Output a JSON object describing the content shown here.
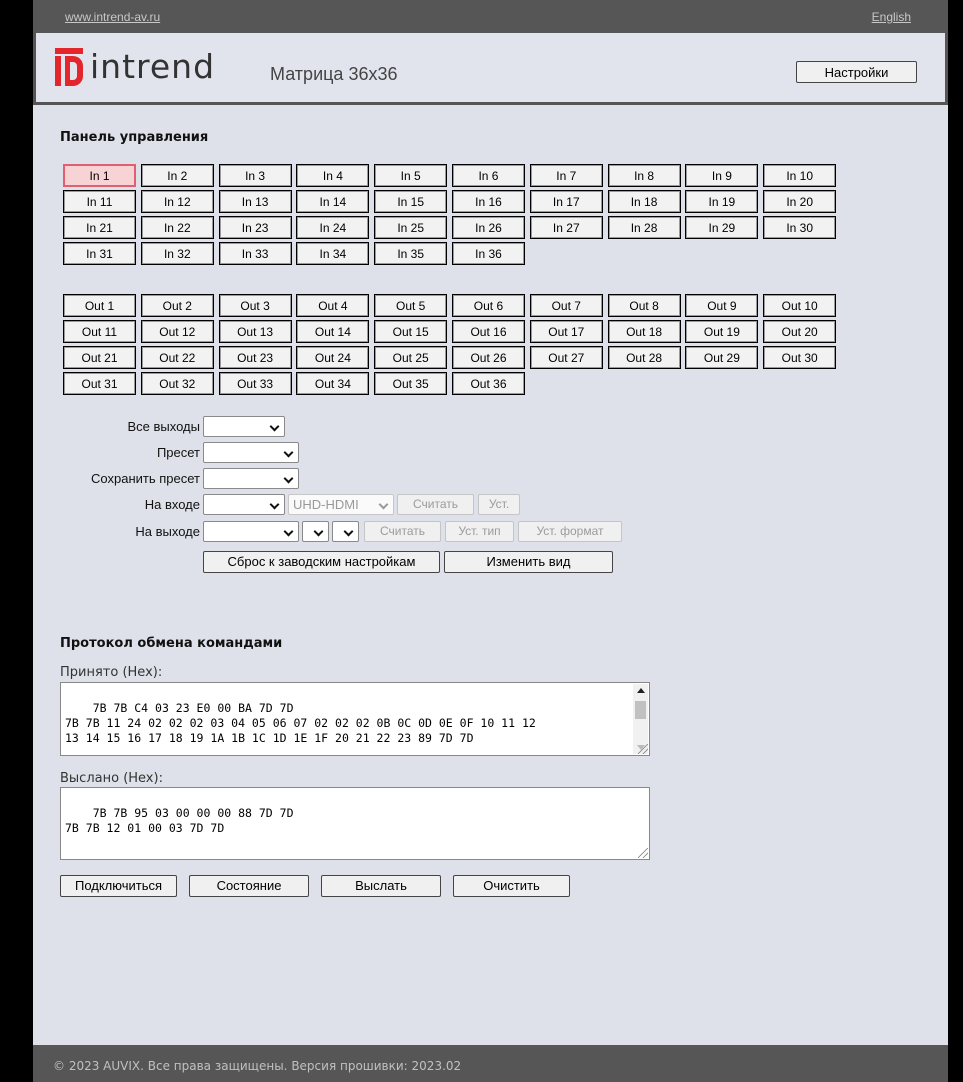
{
  "topbar": {
    "site": "www.intrend-av.ru",
    "lang": "English"
  },
  "header": {
    "brand": "intrend",
    "product": "Матрица 36x36",
    "settings_label": "Настройки",
    "accent_color": "#e4262c"
  },
  "panel": {
    "title": "Панель управления",
    "inputs": [
      "In 1",
      "In 2",
      "In 3",
      "In 4",
      "In 5",
      "In 6",
      "In 7",
      "In 8",
      "In 9",
      "In 10",
      "In 11",
      "In 12",
      "In 13",
      "In 14",
      "In 15",
      "In 16",
      "In 17",
      "In 18",
      "In 19",
      "In 20",
      "In 21",
      "In 22",
      "In 23",
      "In 24",
      "In 25",
      "In 26",
      "In 27",
      "In 28",
      "In 29",
      "In 30",
      "In 31",
      "In 32",
      "In 33",
      "In 34",
      "In 35",
      "In 36"
    ],
    "selected_input": "In 1",
    "outputs": [
      "Out 1",
      "Out 2",
      "Out 3",
      "Out 4",
      "Out 5",
      "Out 6",
      "Out 7",
      "Out 8",
      "Out 9",
      "Out 10",
      "Out 11",
      "Out 12",
      "Out 13",
      "Out 14",
      "Out 15",
      "Out 16",
      "Out 17",
      "Out 18",
      "Out 19",
      "Out 20",
      "Out 21",
      "Out 22",
      "Out 23",
      "Out 24",
      "Out 25",
      "Out 26",
      "Out 27",
      "Out 28",
      "Out 29",
      "Out 30",
      "Out 31",
      "Out 32",
      "Out 33",
      "Out 34",
      "Out 35",
      "Out 36"
    ]
  },
  "controls": {
    "all_outputs_label": "Все выходы",
    "preset_label": "Пресет",
    "save_preset_label": "Сохранить пресет",
    "on_input_label": "На входе",
    "input_format_value": "UHD-HDMI",
    "read_label": "Считать",
    "set_label": "Уст.",
    "on_output_label": "На выходе",
    "set_type_label": "Уст. тип",
    "set_format_label": "Уст. формат",
    "factory_reset_label": "Сброс к заводским настройкам",
    "change_view_label": "Изменить вид"
  },
  "protocol": {
    "title": "Протокол обмена командами",
    "received_label": "Принято (Hex):",
    "received_text": "7B 7B C4 03 23 E0 00 BA 7D 7D\n7B 7B 11 24 02 02 02 03 04 05 06 07 02 02 02 0B 0C 0D 0E 0F 10 11 12\n13 14 15 16 17 18 19 1A 1B 1C 1D 1E 1F 20 21 22 23 89 7D 7D",
    "sent_label": "Выслано (Hex):",
    "sent_text": "7B 7B 95 03 00 00 00 88 7D 7D\n7B 7B 12 01 00 03 7D 7D",
    "connect_label": "Подключиться",
    "status_label": "Состояние",
    "send_label": "Выслать",
    "clear_label": "Очистить"
  },
  "footer": {
    "text": "© 2023 AUVIX. Все права защищены. Версия прошивки:  2023.02"
  }
}
